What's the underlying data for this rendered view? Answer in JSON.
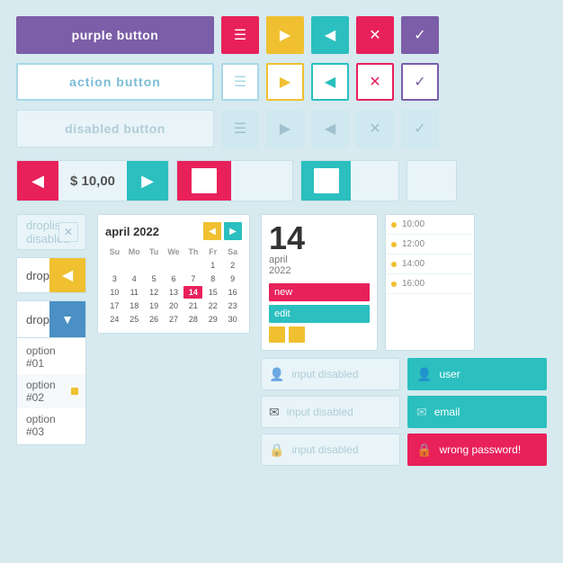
{
  "colors": {
    "purple": "#7b5ea7",
    "pink": "#e8215a",
    "yellow": "#f0c030",
    "teal": "#2bbfbf",
    "blue": "#4a90c4",
    "lightbg": "#d6eaf0",
    "disabled": "#b0cdd8"
  },
  "row1": {
    "purple_btn": "purple button",
    "icons": [
      "☰",
      "▶",
      "◀",
      "✕",
      "✓"
    ],
    "icon_colors": [
      "#e8215a",
      "#f0c030",
      "#2bbfbf",
      "#e8215a",
      "#7b5ea7"
    ]
  },
  "row2": {
    "action_btn": "action button",
    "icons": [
      "☰",
      "▶",
      "◀",
      "✕",
      "✓"
    ]
  },
  "row3": {
    "disabled_btn": "disabled button",
    "icons": [
      "☰",
      "▶",
      "◀",
      "✕",
      "✓"
    ]
  },
  "stepper": {
    "value": "$ 10,00",
    "left_color": "#e8215a",
    "right_color": "#2bbfbf"
  },
  "droplists": {
    "disabled_label": "droplist disabled",
    "droplist1_label": "droplist",
    "droplist2_label": "droplist",
    "options": [
      "option #01",
      "option #02",
      "option #03"
    ]
  },
  "calendar": {
    "title": "april 2022",
    "days_header": [
      "Su",
      "Mo",
      "Tu",
      "We",
      "Th",
      "Fr",
      "Sa"
    ],
    "weeks": [
      [
        "",
        "",
        "",
        "",
        "",
        "1",
        "2"
      ],
      [
        "3",
        "4",
        "5",
        "6",
        "7",
        "8",
        "9"
      ],
      [
        "10",
        "11",
        "12",
        "13",
        "14",
        "15",
        "16"
      ],
      [
        "17",
        "18",
        "19",
        "20",
        "21",
        "22",
        "23"
      ],
      [
        "24",
        "25",
        "26",
        "27",
        "28",
        "29",
        "30"
      ]
    ],
    "today": "14"
  },
  "date_card": {
    "day": "14",
    "month_year": "april\n2022",
    "btn_new": "new",
    "btn_edit": "edit",
    "btn_new_color": "#e8215a",
    "btn_edit_color": "#2bbfbf"
  },
  "schedule": {
    "times": [
      "10:00",
      "12:00",
      "14:00",
      "16:00"
    ]
  },
  "inputs_left": {
    "placeholder1": "input disabled",
    "placeholder2": "input disabled",
    "placeholder3": "input disabled"
  },
  "inputs_right": {
    "user_label": "user",
    "email_label": "email",
    "error_label": "wrong password!"
  }
}
